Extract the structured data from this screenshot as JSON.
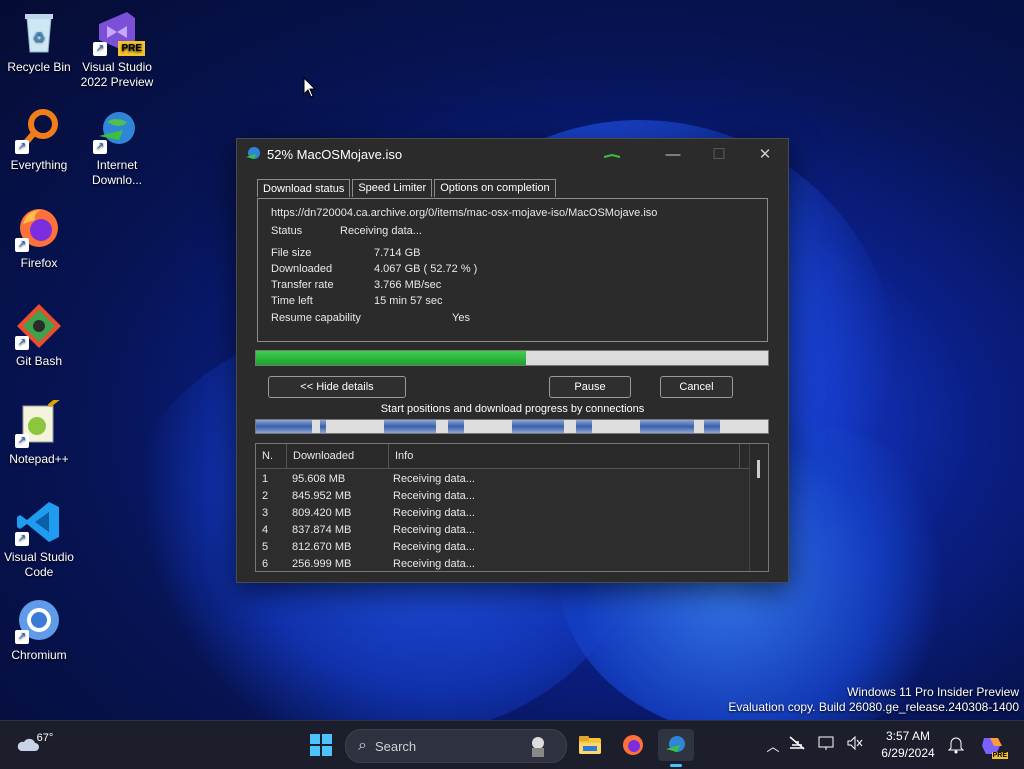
{
  "desktop": {
    "icons": [
      {
        "label_lines": [
          "Recycle Bin"
        ]
      },
      {
        "label_lines": [
          "Visual Studio",
          "2022 Preview"
        ],
        "badge": "PRE"
      },
      {
        "label_lines": [
          "Everything"
        ]
      },
      {
        "label_lines": [
          "Internet",
          "Downlo..."
        ]
      },
      {
        "label_lines": [
          "Firefox"
        ]
      },
      {
        "label_lines": [
          "Git Bash"
        ]
      },
      {
        "label_lines": [
          "Notepad++"
        ]
      },
      {
        "label_lines": [
          "Visual Studio",
          "Code"
        ]
      },
      {
        "label_lines": [
          "Chromium"
        ]
      }
    ]
  },
  "window": {
    "title": "52% MacOSMojave.iso",
    "controls": {
      "minimize": "—",
      "maximize": "☐",
      "close": "✕"
    },
    "tabs": [
      "Download status",
      "Speed Limiter",
      "Options on completion"
    ],
    "url": "https://dn720004.ca.archive.org/0/items/mac-osx-mojave-iso/MacOSMojave.iso",
    "status_label": "Status",
    "status_value": "Receiving data...",
    "fields": [
      {
        "label": "File size",
        "value": "7.714  GB"
      },
      {
        "label": "Downloaded",
        "value": "4.067  GB  ( 52.72 % )"
      },
      {
        "label": "Transfer rate",
        "value": "3.766  MB/sec"
      },
      {
        "label": "Time left",
        "value": "15 min 57 sec"
      }
    ],
    "resume_label": "Resume capability",
    "resume_value": "Yes",
    "progress_fraction": 0.5272,
    "buttons": {
      "hide_details": "<< Hide details",
      "pause": "Pause",
      "cancel": "Cancel"
    },
    "connections_label": "Start positions and download progress by connections",
    "table": {
      "headers": [
        "N.",
        "Downloaded",
        "Info"
      ],
      "rows": [
        {
          "n": "1",
          "downloaded": "95.608  MB",
          "info": "Receiving data..."
        },
        {
          "n": "2",
          "downloaded": "845.952  MB",
          "info": "Receiving data..."
        },
        {
          "n": "3",
          "downloaded": "809.420  MB",
          "info": "Receiving data..."
        },
        {
          "n": "4",
          "downloaded": "837.874  MB",
          "info": "Receiving data..."
        },
        {
          "n": "5",
          "downloaded": "812.670  MB",
          "info": "Receiving data..."
        },
        {
          "n": "6",
          "downloaded": "256.999  MB",
          "info": "Receiving data..."
        }
      ]
    }
  },
  "watermark": {
    "line1": "Windows 11 Pro Insider Preview",
    "line2": "Evaluation copy. Build 26080.ge_release.240308-1400"
  },
  "taskbar": {
    "weather_temp": "67°",
    "search_placeholder": "Search",
    "time": "3:57 AM",
    "date": "6/29/2024",
    "copilot_badge": "PRE"
  },
  "colors": {
    "accent": "#1ea12e",
    "window_bg": "#2b2b2b",
    "taskbar_bg": "#1c1f2b"
  }
}
